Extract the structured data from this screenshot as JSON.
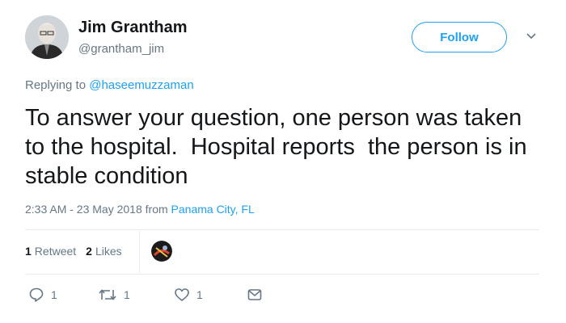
{
  "author": {
    "name": "Jim Grantham",
    "handle": "@grantham_jim",
    "avatar_icon": "profile-photo"
  },
  "follow_label": "Follow",
  "reply_prefix": "Replying to ",
  "reply_to": "@haseemuzzaman",
  "text": "To answer your question, one person was taken to the hospital.  Hospital reports  the person is in stable condition",
  "timestamp": "2:33 AM - 23 May 2018 from ",
  "location": "Panama City, FL",
  "stats": {
    "retweets_count": "1",
    "retweets_label": "Retweet",
    "likes_count": "2",
    "likes_label": "Likes"
  },
  "actions": {
    "reply_count": "1",
    "retweet_count": "1",
    "like_count": "1"
  },
  "colors": {
    "accent": "#1da1f2",
    "secondary_text": "#657786",
    "primary_text": "#14171a",
    "divider": "#e6ecf0"
  }
}
